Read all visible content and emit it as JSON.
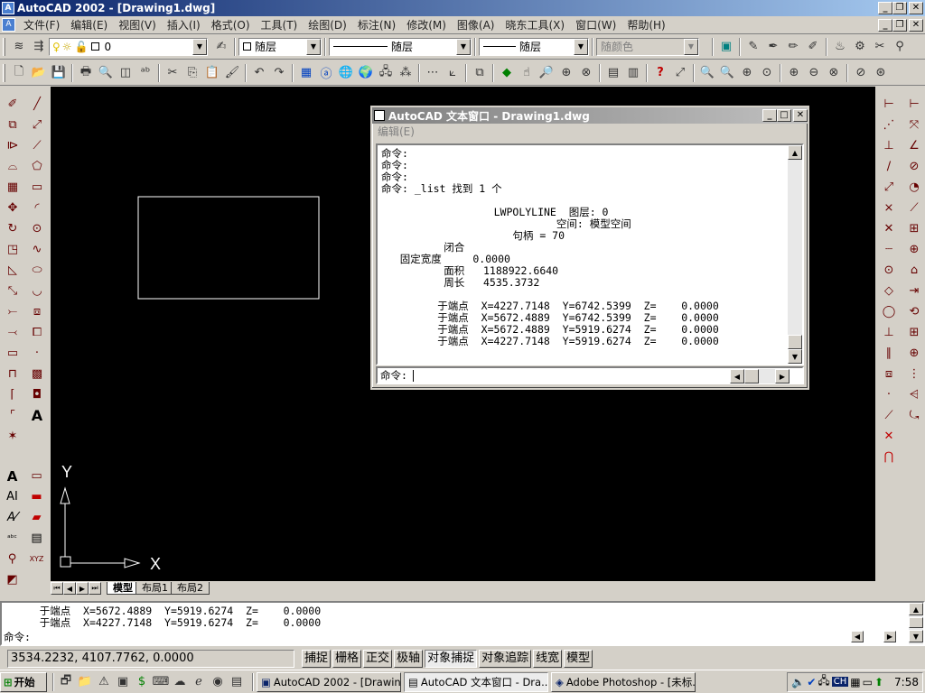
{
  "app": {
    "title": "AutoCAD 2002 - [Drawing1.dwg]"
  },
  "menu": [
    "文件(F)",
    "编辑(E)",
    "视图(V)",
    "插入(I)",
    "格式(O)",
    "工具(T)",
    "绘图(D)",
    "标注(N)",
    "修改(M)",
    "图像(A)",
    "晓东工具(X)",
    "窗口(W)",
    "帮助(H)"
  ],
  "layer_toolbar": {
    "layer_value": "0",
    "layer_combo": "随层",
    "linetype": "随层",
    "lineweight": "随层",
    "color": "随颜色"
  },
  "text_window": {
    "title": "AutoCAD 文本窗口 - Drawing1.dwg",
    "menu_edit": "编辑(E)",
    "lines": [
      "命令:",
      "命令:",
      "命令:",
      "命令: _list 找到 1 个",
      "",
      "                  LWPOLYLINE  图层: 0",
      "                            空间: 模型空间",
      "                     句柄 = 70",
      "          闭合",
      "   固定宽度     0.0000",
      "          面积   1188922.6640",
      "          周长   4535.3732",
      "",
      "         于端点  X=4227.7148  Y=6742.5399  Z=    0.0000",
      "         于端点  X=5672.4889  Y=6742.5399  Z=    0.0000",
      "         于端点  X=5672.4889  Y=5919.6274  Z=    0.0000",
      "         于端点  X=4227.7148  Y=5919.6274  Z=    0.0000"
    ],
    "prompt": "命令:"
  },
  "tabs": [
    "模型",
    "布局1",
    "布局2"
  ],
  "ucs": {
    "x": "X",
    "y": "Y"
  },
  "command_line": {
    "lines": [
      "    于端点  X=5672.4889  Y=5919.6274  Z=    0.0000",
      "    于端点  X=4227.7148  Y=5919.6274  Z=    0.0000"
    ],
    "prompt": "命令:"
  },
  "status": {
    "coords": "3534.2232, 4107.7762, 0.0000",
    "buttons": [
      "捕捉",
      "栅格",
      "正交",
      "极轴",
      "对象捕捉",
      "对象追踪",
      "线宽",
      "模型"
    ]
  },
  "taskbar": {
    "start": "开始",
    "tasks": [
      "AutoCAD 2002 - [Drawing...",
      "AutoCAD 文本窗口 - Dra...",
      "Adobe Photoshop - [未标..."
    ],
    "lang": "CH",
    "clock": "7:58"
  },
  "colors": {
    "title_active": "#0a246a",
    "title_inactive": "#808080",
    "canvas": "#000000"
  }
}
